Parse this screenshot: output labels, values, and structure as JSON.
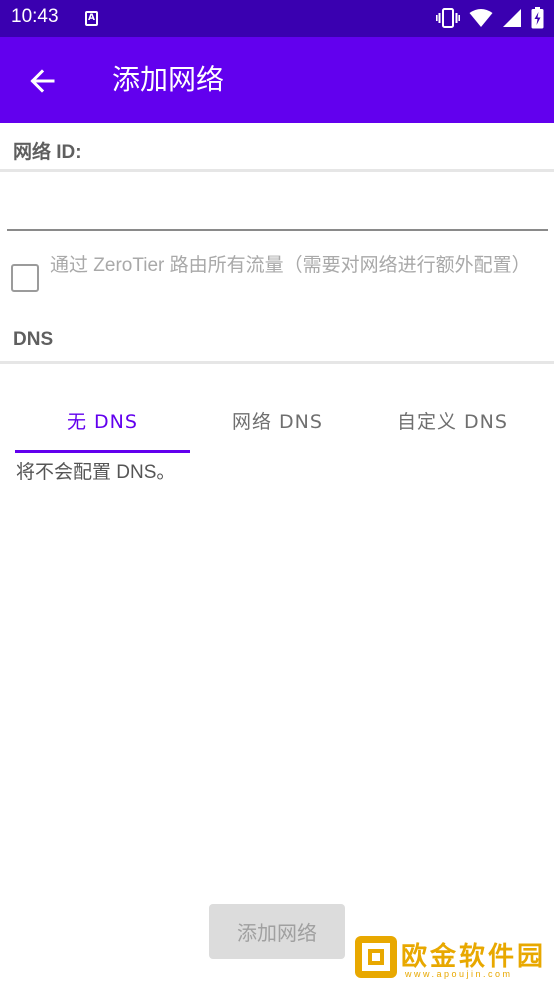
{
  "status_bar": {
    "time": "10:43",
    "app_icon_letter": "A",
    "icons": [
      "vibrate-icon",
      "wifi-icon",
      "signal-icon",
      "battery-icon"
    ]
  },
  "app_bar": {
    "back_icon": "arrow-left-icon",
    "title": "添加网络"
  },
  "network_id": {
    "label": "网络 ID:",
    "value": "",
    "placeholder": ""
  },
  "route_all": {
    "checked": false,
    "label": "通过 ZeroTier 路由所有流量（需要对网络进行额外配置）"
  },
  "dns": {
    "label": "DNS",
    "tabs": [
      {
        "label": "无 DNS",
        "active": true
      },
      {
        "label": "网络 DNS",
        "active": false
      },
      {
        "label": "自定义 DNS",
        "active": false
      }
    ],
    "description": "将不会配置 DNS。"
  },
  "add_button": {
    "label": "添加网络",
    "enabled": false
  },
  "watermark": {
    "text": "欧金软件园",
    "url": "www.apoujin.com"
  },
  "colors": {
    "status_bar": "#3a00b0",
    "primary": "#6200ee",
    "disabled_button": "#dcdcdc",
    "watermark": "#e8a800"
  }
}
